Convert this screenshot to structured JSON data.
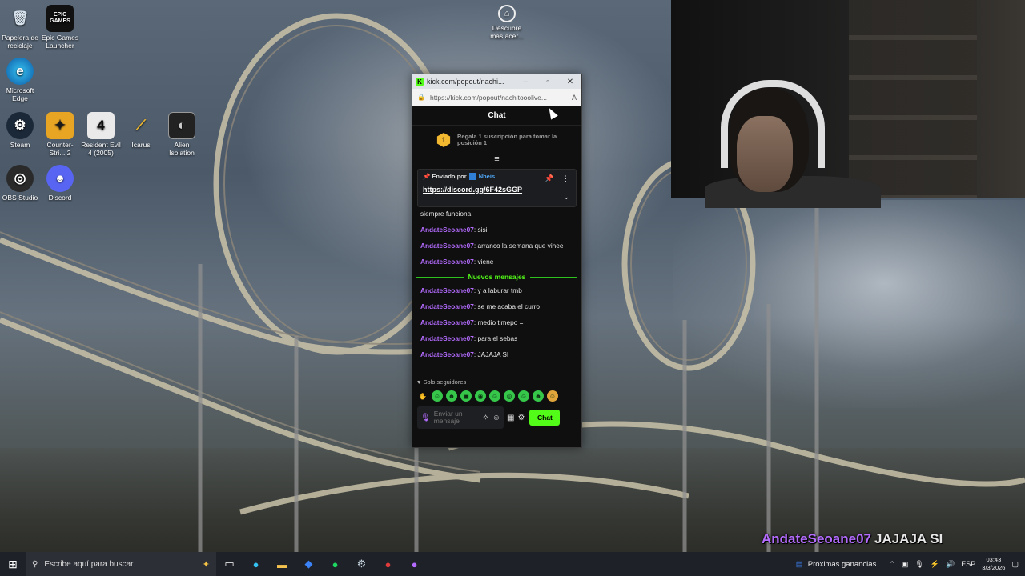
{
  "desktop": {
    "icons": [
      {
        "label": "Papelera de reciclaje",
        "icon": "recycle-bin-icon"
      },
      {
        "label": "Epic Games Launcher",
        "icon": "epic-games-icon"
      },
      {
        "label": "Microsoft Edge",
        "icon": "edge-icon"
      },
      {
        "label": "Steam",
        "icon": "steam-icon"
      },
      {
        "label": "Counter-Stri... 2",
        "icon": "counter-strike-icon"
      },
      {
        "label": "Resident Evil 4 (2005)",
        "icon": "resident-evil-icon"
      },
      {
        "label": "Icarus",
        "icon": "icarus-icon"
      },
      {
        "label": "Alien Isolation",
        "icon": "alien-icon"
      },
      {
        "label": "OBS Studio",
        "icon": "obs-icon"
      },
      {
        "label": "Discord",
        "icon": "discord-icon"
      },
      {
        "label": "Descubre más acer...",
        "icon": "discover-icon"
      }
    ],
    "epic_logo_text": "EPIC GAMES"
  },
  "browser": {
    "tab_title": "kick.com/popout/nachi...",
    "url": "https://kick.com/popout/nachitooolive...",
    "favicon": "K"
  },
  "chat": {
    "header": "Chat",
    "promo_badge": "1",
    "promo_text": "Regala 1 suscripción para tomar la posición 1",
    "pinned": {
      "sent_by_label": "Enviado por",
      "sender": "Nheis",
      "link": "https://discord.gg/6F42sGGP"
    },
    "messages_before": [
      {
        "user": "",
        "text": "siempre funciona"
      },
      {
        "user": "AndateSeoane07",
        "text": "sisi"
      },
      {
        "user": "AndateSeoane07",
        "text": "arranco la semana que vinee"
      },
      {
        "user": "AndateSeoane07",
        "text": "viene"
      }
    ],
    "new_messages_label": "Nuevos mensajes",
    "messages_after": [
      {
        "user": "AndateSeoane07",
        "text": "y a laburar tmb"
      },
      {
        "user": "AndateSeoane07",
        "text": "se me acaba el curro"
      },
      {
        "user": "AndateSeoane07",
        "text": "medio timepo ="
      },
      {
        "user": "AndateSeoane07",
        "text": "para el sebas"
      },
      {
        "user": "AndateSeoane07",
        "text": "JAJAJA SI"
      }
    ],
    "followers_only": "Solo seguidores",
    "input_placeholder": "Enviar un mensaje",
    "send_label": "Chat"
  },
  "overlay": {
    "user": "AndateSeoane07",
    "message": "JAJAJA SI"
  },
  "taskbar": {
    "search_placeholder": "Escribe aquí para buscar",
    "news": "Próximas ganancias",
    "language": "ESP",
    "time": "03:43",
    "date": "3/3/2026"
  },
  "colors": {
    "kick_green": "#53fc18",
    "username_purple": "#b46cff"
  }
}
